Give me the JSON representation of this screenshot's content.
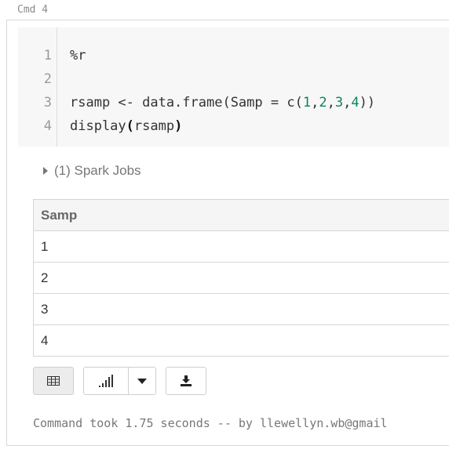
{
  "cell": {
    "label": "Cmd 4",
    "code": {
      "line_numbers": [
        "1",
        "2",
        "3",
        "4"
      ],
      "lines": [
        {
          "parts": [
            {
              "text": "%r",
              "style": "plain"
            }
          ]
        },
        {
          "parts": []
        },
        {
          "parts": [
            {
              "text": "rsamp <- data.frame(Samp = c(",
              "style": "plain"
            },
            {
              "text": "1",
              "style": "num"
            },
            {
              "text": ",",
              "style": "plain"
            },
            {
              "text": "2",
              "style": "num"
            },
            {
              "text": ",",
              "style": "plain"
            },
            {
              "text": "3",
              "style": "num"
            },
            {
              "text": ",",
              "style": "plain"
            },
            {
              "text": "4",
              "style": "num"
            },
            {
              "text": "))",
              "style": "plain"
            }
          ]
        },
        {
          "parts": [
            {
              "text": "display",
              "style": "plain"
            },
            {
              "text": "(",
              "style": "bold"
            },
            {
              "text": "rsamp",
              "style": "plain"
            },
            {
              "text": ")",
              "style": "bold"
            }
          ]
        }
      ]
    },
    "spark_jobs": "(1) Spark Jobs",
    "table": {
      "header": "Samp",
      "rows": [
        "1",
        "2",
        "3",
        "4"
      ]
    },
    "status": "Command took 1.75 seconds -- by llewellyn.wb@gmail"
  },
  "colors": {
    "number": "#098658",
    "editor_bg": "#f7f7f7",
    "muted_text": "#777777"
  },
  "icons": {
    "table_view": "table-icon",
    "chart_view": "bar-chart-icon",
    "chart_options": "caret-down-icon",
    "download": "download-icon",
    "expand": "caret-right-icon"
  }
}
